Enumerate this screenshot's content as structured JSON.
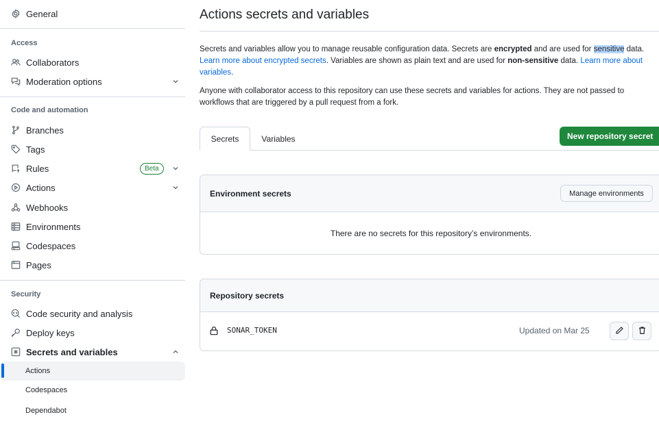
{
  "sidebar": {
    "general": "General",
    "access_heading": "Access",
    "collaborators": "Collaborators",
    "moderation": "Moderation options",
    "code_heading": "Code and automation",
    "branches": "Branches",
    "tags": "Tags",
    "rules": "Rules",
    "rules_badge": "Beta",
    "actions": "Actions",
    "webhooks": "Webhooks",
    "environments": "Environments",
    "codespaces": "Codespaces",
    "pages": "Pages",
    "security_heading": "Security",
    "code_security": "Code security and analysis",
    "deploy_keys": "Deploy keys",
    "secrets_variables": "Secrets and variables",
    "sub_items": [
      "Actions",
      "Codespaces",
      "Dependabot"
    ]
  },
  "main": {
    "title": "Actions secrets and variables",
    "intro": {
      "t1": "Secrets and variables allow you to manage reusable configuration data. Secrets are ",
      "b1": "encrypted",
      "t2": " and are used for ",
      "hl": "sensitive",
      "t3": " data. ",
      "link1": "Learn more about encrypted secrets",
      "t4": ". Variables are shown as plain text and are used for ",
      "b2": "non-sensitive",
      "t5": " data. ",
      "link2": "Learn more about variables",
      "t6": "."
    },
    "access_note": "Anyone with collaborator access to this repository can use these secrets and variables for actions. They are not passed to workflows that are triggered by a pull request from a fork.",
    "tabs": [
      "Secrets",
      "Variables"
    ],
    "new_secret_button": "New repository secret",
    "env_secrets": {
      "heading": "Environment secrets",
      "manage_button": "Manage environments",
      "empty": "There are no secrets for this repository’s environments."
    },
    "repo_secrets": {
      "heading": "Repository secrets",
      "rows": [
        {
          "name": "SONAR_TOKEN",
          "updated": "Updated on Mar 25"
        }
      ]
    }
  },
  "colors": {
    "accent": "#0969da",
    "primary_button": "#1f883d",
    "border": "#d1d9e0",
    "muted_text": "#59636e"
  }
}
